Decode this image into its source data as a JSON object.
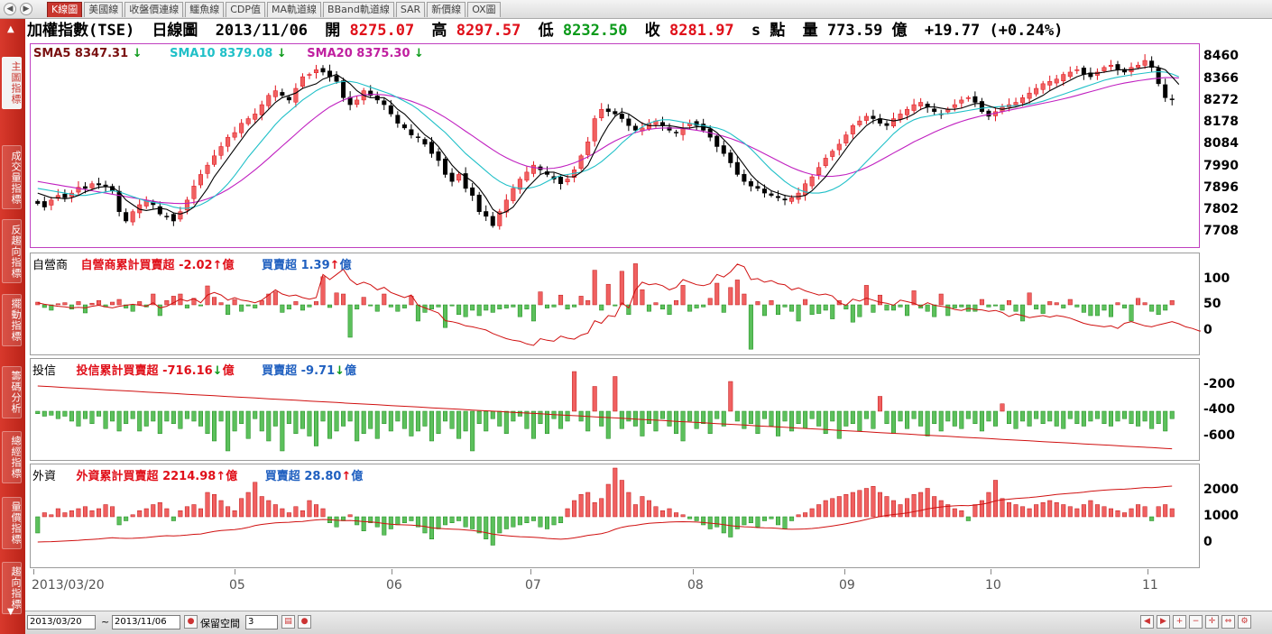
{
  "tabs": [
    {
      "label": "K線圖",
      "active": true
    },
    {
      "label": "美國線",
      "active": false
    },
    {
      "label": "收盤價連線",
      "active": false
    },
    {
      "label": "鱷魚線",
      "active": false
    },
    {
      "label": "CDP值",
      "active": false
    },
    {
      "label": "MA軌道線",
      "active": false
    },
    {
      "label": "BBand軌道線",
      "active": false
    },
    {
      "label": "SAR",
      "active": false
    },
    {
      "label": "新價線",
      "active": false
    },
    {
      "label": "OX圖",
      "active": false
    }
  ],
  "sidebar": {
    "items": [
      {
        "label": "主圖指標",
        "active": true
      },
      {
        "label": "成交量指標",
        "active": false
      },
      {
        "label": "反趨向指標",
        "active": false
      },
      {
        "label": "擺動指標",
        "active": false
      },
      {
        "label": "籌碼分析",
        "active": false
      },
      {
        "label": "總經指標",
        "active": false
      },
      {
        "label": "量價指標",
        "active": false
      },
      {
        "label": "趨向指標",
        "active": false
      }
    ],
    "up_arrow": "▲",
    "down_arrow": "▼"
  },
  "header": {
    "name": "加權指數(TSE)",
    "period": "日線圖",
    "date": "2013/11/06",
    "open_label": "開",
    "open": "8275.07",
    "high_label": "高",
    "high": "8297.57",
    "low_label": "低",
    "low": "8232.50",
    "close_label": "收",
    "close": "8281.97",
    "unit": "s 點",
    "volume_label": "量",
    "volume": "773.59 億",
    "change": "+19.77 (+0.24%)"
  },
  "colors": {
    "up": "#e0101a",
    "down": "#0c9a1a",
    "candle_up_fill": "#f06060",
    "candle_down_fill": "#000000",
    "sma5": "#000000",
    "sma10": "#20c0c8",
    "sma20": "#c020c0",
    "panel_border_main": "#c040c0"
  },
  "main_legend": {
    "sma5": "SMA5 8347.31",
    "sma10": "SMA10 8379.08",
    "sma20": "SMA20 8375.30",
    "arrow": "↓"
  },
  "dealer_panel": {
    "title": "自營商",
    "cum_label": "自營商累計買賣超",
    "cum_value": "-2.02",
    "cum_arrow": "↑",
    "net_label": "買賣超",
    "net_value": "1.39",
    "net_arrow": "↑",
    "unit": "億",
    "ticks": [
      "100",
      "50",
      "0"
    ]
  },
  "trust_panel": {
    "title": "投信",
    "cum_label": "投信累計買賣超",
    "cum_value": "-716.16",
    "cum_arrow": "↓",
    "net_label": "買賣超",
    "net_value": "-9.71",
    "net_arrow": "↓",
    "unit": "億",
    "ticks": [
      "-200",
      "-400",
      "-600"
    ]
  },
  "foreign_panel": {
    "title": "外資",
    "cum_label": "外資累計買賣超",
    "cum_value": "2214.98",
    "cum_arrow": "↑",
    "net_label": "買賣超",
    "net_value": "28.80",
    "net_arrow": "↑",
    "unit": "億",
    "ticks": [
      "2000",
      "1000",
      "0"
    ]
  },
  "x_axis": {
    "labels": [
      "2013/03/20",
      "05",
      "06",
      "07",
      "08",
      "09",
      "10",
      "11"
    ]
  },
  "bottombar": {
    "start_date": "2013/03/20",
    "end_date": "2013/11/06",
    "tilde": "~",
    "reserve_label": "保留空間",
    "reserve_value": "3"
  },
  "chart_data": {
    "type": "candlestick",
    "title": "加權指數(TSE) 日線圖",
    "y_ticks": [
      8460,
      8366,
      8272,
      8178,
      8084,
      7990,
      7896,
      7802,
      7708
    ],
    "ylim": [
      7640,
      8520
    ],
    "x_tick_labels": [
      "2013/03/20",
      "05",
      "06",
      "07",
      "08",
      "09",
      "10",
      "11"
    ],
    "closes": [
      7835,
      7820,
      7850,
      7870,
      7860,
      7880,
      7905,
      7900,
      7920,
      7915,
      7910,
      7890,
      7800,
      7760,
      7800,
      7830,
      7850,
      7830,
      7790,
      7780,
      7760,
      7800,
      7850,
      7910,
      7960,
      8000,
      8040,
      8080,
      8120,
      8140,
      8180,
      8200,
      8220,
      8260,
      8300,
      8320,
      8300,
      8280,
      8330,
      8380,
      8390,
      8410,
      8400,
      8380,
      8360,
      8290,
      8260,
      8280,
      8320,
      8300,
      8280,
      8260,
      8220,
      8180,
      8160,
      8130,
      8120,
      8090,
      8050,
      8020,
      7960,
      7930,
      7960,
      7900,
      7870,
      7800,
      7780,
      7740,
      7800,
      7850,
      7900,
      7940,
      7970,
      8000,
      7980,
      7960,
      7940,
      7920,
      7940,
      7980,
      8040,
      8100,
      8200,
      8240,
      8230,
      8220,
      8200,
      8170,
      8150,
      8160,
      8180,
      8190,
      8170,
      8150,
      8140,
      8160,
      8180,
      8170,
      8150,
      8120,
      8080,
      8050,
      8010,
      7960,
      7930,
      7910,
      7900,
      7880,
      7870,
      7860,
      7850,
      7860,
      7880,
      7920,
      7950,
      7990,
      8030,
      8060,
      8090,
      8130,
      8170,
      8190,
      8210,
      8200,
      8180,
      8170,
      8200,
      8220,
      8240,
      8260,
      8270,
      8250,
      8230,
      8220,
      8240,
      8260,
      8280,
      8290,
      8270,
      8230,
      8210,
      8230,
      8250,
      8260,
      8270,
      8290,
      8310,
      8330,
      8350,
      8360,
      8370,
      8390,
      8400,
      8410,
      8390,
      8380,
      8400,
      8420,
      8430,
      8410,
      8400,
      8420,
      8430,
      8450,
      8420,
      8350,
      8290,
      8282
    ],
    "sma5": [
      7880,
      7870,
      7860,
      7860,
      7855,
      7860,
      7870,
      7885,
      7895,
      7905,
      7908,
      7905,
      7885,
      7850,
      7830,
      7810,
      7805,
      7810,
      7815,
      7810,
      7795,
      7790,
      7800,
      7820,
      7860,
      7900,
      7950,
      7990,
      8030,
      8070,
      8110,
      8150,
      8180,
      8210,
      8240,
      8270,
      8290,
      8300,
      8310,
      8330,
      8340,
      8350,
      8370,
      8380,
      8390,
      8370,
      8350,
      8320,
      8300,
      8290,
      8290,
      8290,
      8270,
      8240,
      8220,
      8190,
      8160,
      8130,
      8110,
      8080,
      8040,
      8000,
      7970,
      7950,
      7930,
      7900,
      7860,
      7810,
      7790,
      7800,
      7820,
      7860,
      7900,
      7930,
      7960,
      7970,
      7970,
      7960,
      7950,
      7950,
      7970,
      8000,
      8060,
      8120,
      8170,
      8210,
      8230,
      8220,
      8200,
      8180,
      8170,
      8170,
      8170,
      8170,
      8165,
      8160,
      8160,
      8165,
      8165,
      8160,
      8140,
      8110,
      8080,
      8040,
      8000,
      7960,
      7930,
      7910,
      7890,
      7880,
      7870,
      7865,
      7865,
      7870,
      7890,
      7920,
      7950,
      7990,
      8030,
      8070,
      8110,
      8140,
      8170,
      8190,
      8200,
      8195,
      8190,
      8195,
      8205,
      8220,
      8240,
      8250,
      8250,
      8245,
      8240,
      8240,
      8245,
      8255,
      8265,
      8265,
      8255,
      8245,
      8240,
      8245,
      8250,
      8260,
      8270,
      8285,
      8300,
      8320,
      8335,
      8350,
      8365,
      8380,
      8390,
      8395,
      8395,
      8400,
      8405,
      8410,
      8410,
      8410,
      8415,
      8420,
      8425,
      8420,
      8410,
      8380,
      8347
    ],
    "sma10": [
      7900,
      7895,
      7890,
      7885,
      7880,
      7875,
      7870,
      7870,
      7875,
      7880,
      7885,
      7890,
      7885,
      7875,
      7865,
      7855,
      7845,
      7840,
      7835,
      7830,
      7820,
      7815,
      7815,
      7820,
      7830,
      7845,
      7865,
      7890,
      7920,
      7955,
      7995,
      8035,
      8070,
      8105,
      8140,
      8175,
      8205,
      8230,
      8255,
      8280,
      8300,
      8320,
      8335,
      8345,
      8355,
      8360,
      8360,
      8355,
      8345,
      8335,
      8325,
      8315,
      8305,
      8290,
      8275,
      8260,
      8240,
      8215,
      8190,
      8165,
      8140,
      8110,
      8080,
      8050,
      8025,
      8000,
      7975,
      7950,
      7930,
      7915,
      7905,
      7900,
      7900,
      7905,
      7915,
      7930,
      7945,
      7955,
      7960,
      7965,
      7970,
      7980,
      7995,
      8015,
      8040,
      8065,
      8095,
      8120,
      8145,
      8165,
      8180,
      8190,
      8195,
      8195,
      8190,
      8185,
      8180,
      8175,
      8170,
      8165,
      8160,
      8150,
      8135,
      8115,
      8095,
      8070,
      8040,
      8010,
      7980,
      7955,
      7930,
      7910,
      7895,
      7885,
      7880,
      7880,
      7885,
      7895,
      7910,
      7930,
      7955,
      7985,
      8015,
      8045,
      8075,
      8105,
      8135,
      8160,
      8180,
      8195,
      8205,
      8210,
      8215,
      8220,
      8222,
      8225,
      8230,
      8235,
      8240,
      8245,
      8248,
      8250,
      8252,
      8254,
      8256,
      8258,
      8262,
      8268,
      8275,
      8285,
      8295,
      8305,
      8315,
      8325,
      8335,
      8345,
      8355,
      8365,
      8372,
      8378,
      8383,
      8388,
      8392,
      8396,
      8400,
      8402,
      8400,
      8392,
      8380
    ],
    "sma20": [
      7930,
      7925,
      7920,
      7915,
      7910,
      7905,
      7900,
      7895,
      7890,
      7885,
      7880,
      7875,
      7870,
      7865,
      7860,
      7855,
      7850,
      7845,
      7840,
      7838,
      7836,
      7835,
      7836,
      7840,
      7846,
      7855,
      7866,
      7880,
      7896,
      7915,
      7935,
      7957,
      7980,
      8004,
      8030,
      8056,
      8082,
      8108,
      8134,
      8160,
      8185,
      8208,
      8230,
      8250,
      8266,
      8280,
      8290,
      8298,
      8302,
      8304,
      8304,
      8302,
      8298,
      8292,
      8284,
      8275,
      8264,
      8252,
      8238,
      8222,
      8205,
      8186,
      8166,
      8146,
      8126,
      8106,
      8086,
      8066,
      8048,
      8032,
      8018,
      8006,
      7996,
      7990,
      7986,
      7985,
      7987,
      7992,
      8000,
      8010,
      8022,
      8036,
      8052,
      8070,
      8088,
      8104,
      8118,
      8130,
      8140,
      8148,
      8154,
      8158,
      8160,
      8160,
      8159,
      8157,
      8154,
      8150,
      8145,
      8139,
      8132,
      8124,
      8115,
      8104,
      8092,
      8078,
      8064,
      8049,
      8034,
      8019,
      8004,
      7990,
      7978,
      7968,
      7960,
      7955,
      7952,
      7952,
      7955,
      7960,
      7968,
      7978,
      7990,
      8004,
      8020,
      8036,
      8052,
      8068,
      8084,
      8100,
      8114,
      8128,
      8142,
      8155,
      8167,
      8178,
      8188,
      8197,
      8205,
      8212,
      8218,
      8224,
      8230,
      8236,
      8242,
      8248,
      8254,
      8260,
      8266,
      8272,
      8278,
      8285,
      8292,
      8300,
      8308,
      8316,
      8324,
      8332,
      8340,
      8347,
      8353,
      8358,
      8363,
      8367,
      8371,
      8374,
      8376,
      8376,
      8375
    ],
    "dealer_net": [
      5,
      -5,
      -10,
      2,
      4,
      -8,
      6,
      -15,
      3,
      8,
      -4,
      5,
      10,
      -6,
      -12,
      6,
      -4,
      20,
      -20,
      8,
      16,
      20,
      -6,
      12,
      -2,
      35,
      14,
      4,
      -18,
      10,
      -12,
      -2,
      -6,
      8,
      20,
      24,
      -14,
      -8,
      6,
      -10,
      -4,
      6,
      52,
      -5,
      22,
      20,
      -60,
      -8,
      14,
      -2,
      -12,
      20,
      -4,
      -12,
      -6,
      16,
      -30,
      -14,
      -8,
      -4,
      -42,
      -2,
      -18,
      -22,
      -10,
      -20,
      -10,
      -14,
      -8,
      -6,
      -4,
      -22,
      -8,
      -30,
      24,
      -6,
      -4,
      18,
      -8,
      -4,
      16,
      8,
      64,
      -10,
      38,
      -2,
      62,
      -18,
      76,
      28,
      -12,
      4,
      -8,
      -18,
      8,
      36,
      -12,
      -6,
      -4,
      12,
      40,
      -14,
      32,
      46,
      20,
      -82,
      6,
      -20,
      8,
      -18,
      -4,
      -12,
      -30,
      10,
      -18,
      -16,
      -10,
      -26,
      8,
      -8,
      -32,
      -22,
      36,
      -14,
      18,
      -10,
      -10,
      -4,
      -20,
      26,
      -6,
      -12,
      -22,
      20,
      -20,
      -6,
      -4,
      -12,
      -12,
      10,
      -4,
      -2,
      -10,
      8,
      -12,
      -30,
      22,
      -8,
      -16,
      6,
      4,
      -6,
      10,
      -4,
      -14,
      -20,
      -20,
      -10,
      -22,
      4,
      -6,
      -30,
      12,
      4,
      -12,
      -18,
      -10,
      8,
      12,
      8,
      -12,
      -30,
      -18,
      -32,
      2,
      -24,
      -6,
      1.39
    ],
    "trust_net": [
      -5,
      -10,
      -8,
      -15,
      -10,
      -20,
      -30,
      -15,
      -25,
      -10,
      -35,
      -20,
      -40,
      -25,
      -15,
      -40,
      -30,
      -20,
      -45,
      -20,
      -25,
      -35,
      -15,
      -20,
      -30,
      -45,
      -60,
      -20,
      -80,
      -40,
      -25,
      -55,
      -15,
      -40,
      -60,
      -30,
      -80,
      -25,
      -45,
      -35,
      -50,
      -70,
      -20,
      -55,
      -40,
      -30,
      -20,
      -60,
      -45,
      -35,
      -55,
      -25,
      -40,
      -20,
      -35,
      -50,
      -40,
      -30,
      -60,
      -45,
      -20,
      -35,
      -55,
      -40,
      -80,
      -25,
      -40,
      -15,
      -30,
      -45,
      -20,
      -10,
      -35,
      -55,
      -25,
      -45,
      -15,
      -35,
      -20,
      80,
      -20,
      -40,
      50,
      -30,
      -55,
      70,
      -35,
      -20,
      -30,
      -50,
      -25,
      -40,
      -15,
      -30,
      -45,
      -60,
      -20,
      -35,
      -25,
      -45,
      -15,
      -30,
      60,
      -20,
      -35,
      -25,
      -45,
      -15,
      -30,
      -50,
      -20,
      -40,
      -25,
      -35,
      -15,
      -30,
      -45,
      -20,
      -55,
      -30,
      -25,
      -40,
      -15,
      -35,
      30,
      -25,
      -45,
      -20,
      -35,
      -15,
      -30,
      -50,
      -25,
      -40,
      -20,
      -30,
      -35,
      -15,
      -25,
      -40,
      -20,
      -30,
      15,
      -25,
      -35,
      -20,
      -30,
      -15,
      -25,
      -20,
      -30,
      -35,
      -15,
      -25,
      -30,
      -20,
      -15,
      -25,
      -30,
      -20,
      -15,
      -25,
      -30,
      -20,
      -35,
      -25,
      -40,
      -15,
      -30,
      -20,
      -10,
      -25,
      -35,
      -60,
      -9.71
    ],
    "foreign_net": [
      -40,
      10,
      5,
      20,
      10,
      15,
      20,
      25,
      15,
      20,
      30,
      25,
      -20,
      -10,
      5,
      15,
      20,
      30,
      35,
      20,
      -10,
      15,
      25,
      30,
      20,
      60,
      55,
      40,
      25,
      15,
      45,
      60,
      85,
      50,
      40,
      30,
      20,
      10,
      25,
      15,
      40,
      30,
      20,
      -15,
      -25,
      -10,
      5,
      -20,
      -35,
      -15,
      -25,
      -45,
      -30,
      -20,
      -15,
      -10,
      -25,
      -40,
      -55,
      -30,
      -20,
      -15,
      -10,
      -25,
      -30,
      -40,
      -55,
      -70,
      -40,
      -30,
      -25,
      -20,
      -15,
      -10,
      -25,
      -30,
      -20,
      -15,
      20,
      40,
      55,
      60,
      35,
      45,
      80,
      120,
      90,
      60,
      30,
      50,
      40,
      25,
      15,
      20,
      10,
      5,
      -5,
      -10,
      -20,
      -30,
      -25,
      -40,
      -50,
      -30,
      -20,
      -15,
      -25,
      -10,
      -5,
      -20,
      -30,
      -10,
      5,
      10,
      20,
      30,
      40,
      45,
      50,
      55,
      60,
      65,
      70,
      75,
      60,
      50,
      40,
      30,
      45,
      55,
      60,
      70,
      50,
      40,
      30,
      20,
      15,
      -10,
      30,
      40,
      60,
      90,
      45,
      35,
      30,
      25,
      20,
      30,
      35,
      40,
      35,
      30,
      25,
      20,
      30,
      40,
      30,
      25,
      20,
      15,
      10,
      20,
      30,
      25,
      -10,
      25,
      30,
      20,
      10,
      -15,
      28.8
    ],
    "dealer_cum_line": [
      55,
      52,
      50,
      48,
      47,
      45,
      46,
      45,
      48,
      50,
      47,
      45,
      48,
      50,
      52,
      50,
      48,
      55,
      45,
      48,
      55,
      62,
      58,
      63,
      55,
      70,
      75,
      70,
      60,
      65,
      60,
      58,
      55,
      60,
      70,
      80,
      72,
      68,
      70,
      65,
      62,
      65,
      110,
      100,
      110,
      120,
      100,
      90,
      95,
      90,
      80,
      85,
      75,
      70,
      65,
      70,
      50,
      45,
      40,
      35,
      20,
      18,
      15,
      10,
      8,
      5,
      2,
      -5,
      -10,
      -15,
      -18,
      -20,
      -25,
      -28,
      -15,
      -18,
      -20,
      -10,
      -14,
      -16,
      -8,
      -4,
      20,
      15,
      30,
      28,
      55,
      45,
      80,
      95,
      90,
      92,
      88,
      80,
      85,
      100,
      95,
      90,
      88,
      92,
      110,
      105,
      115,
      130,
      125,
      100,
      102,
      95,
      98,
      92,
      90,
      80,
      84,
      78,
      74,
      70,
      72,
      68,
      55,
      50,
      62,
      58,
      64,
      60,
      56,
      54,
      50,
      60,
      57,
      54,
      48,
      55,
      50,
      48,
      46,
      42,
      40,
      44,
      42,
      41,
      38,
      40,
      36,
      28,
      33,
      30,
      26,
      28,
      30,
      27,
      30,
      28,
      25,
      20,
      15,
      12,
      10,
      8,
      10,
      5,
      15,
      18,
      14,
      10,
      8,
      12,
      15,
      18,
      14,
      8,
      5,
      0,
      0,
      0,
      2
    ]
  }
}
